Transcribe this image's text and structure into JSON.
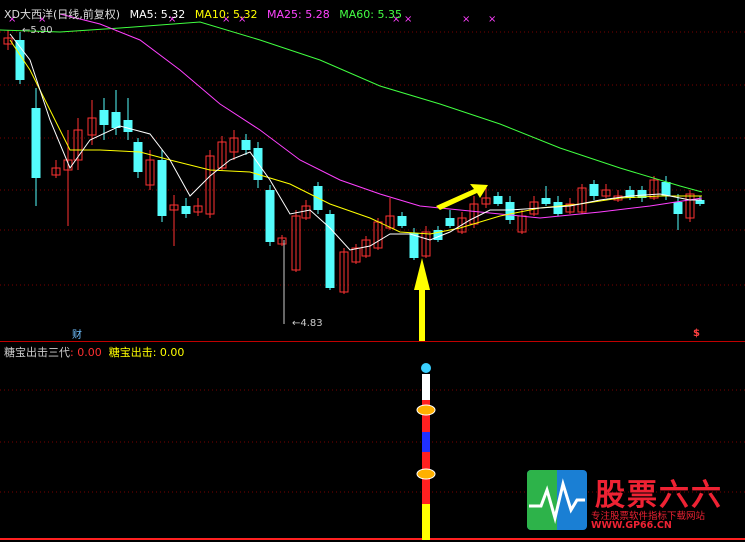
{
  "main": {
    "title": "XD大西洋(日线,前复权)",
    "ma5": {
      "label": "MA5: 5.32",
      "color": "#ffffff"
    },
    "ma10": {
      "label": "MA10: 5.32",
      "color": "#ffff00"
    },
    "ma25": {
      "label": "MA25: 5.28",
      "color": "#ff40ff"
    },
    "ma60": {
      "label": "MA60: 5.35",
      "color": "#40ff40"
    },
    "high_label": "5.90",
    "low_label": "4.83",
    "fin_label": "财",
    "s_label": "$"
  },
  "sub": {
    "ind1_name": "糖宝出击三代",
    "ind1_value": ": 0.00",
    "ind2_name": "糖宝出击:",
    "ind2_value": " 0.00"
  },
  "watermark": {
    "title": "股票六六",
    "slogan": "专注股票软件指标下载网站",
    "url": "WWW.GP66.CN"
  },
  "colors": {
    "up": "#ff3232",
    "down": "#54fcfc",
    "divider": "#c00000",
    "arrow": "#ffff00"
  }
}
